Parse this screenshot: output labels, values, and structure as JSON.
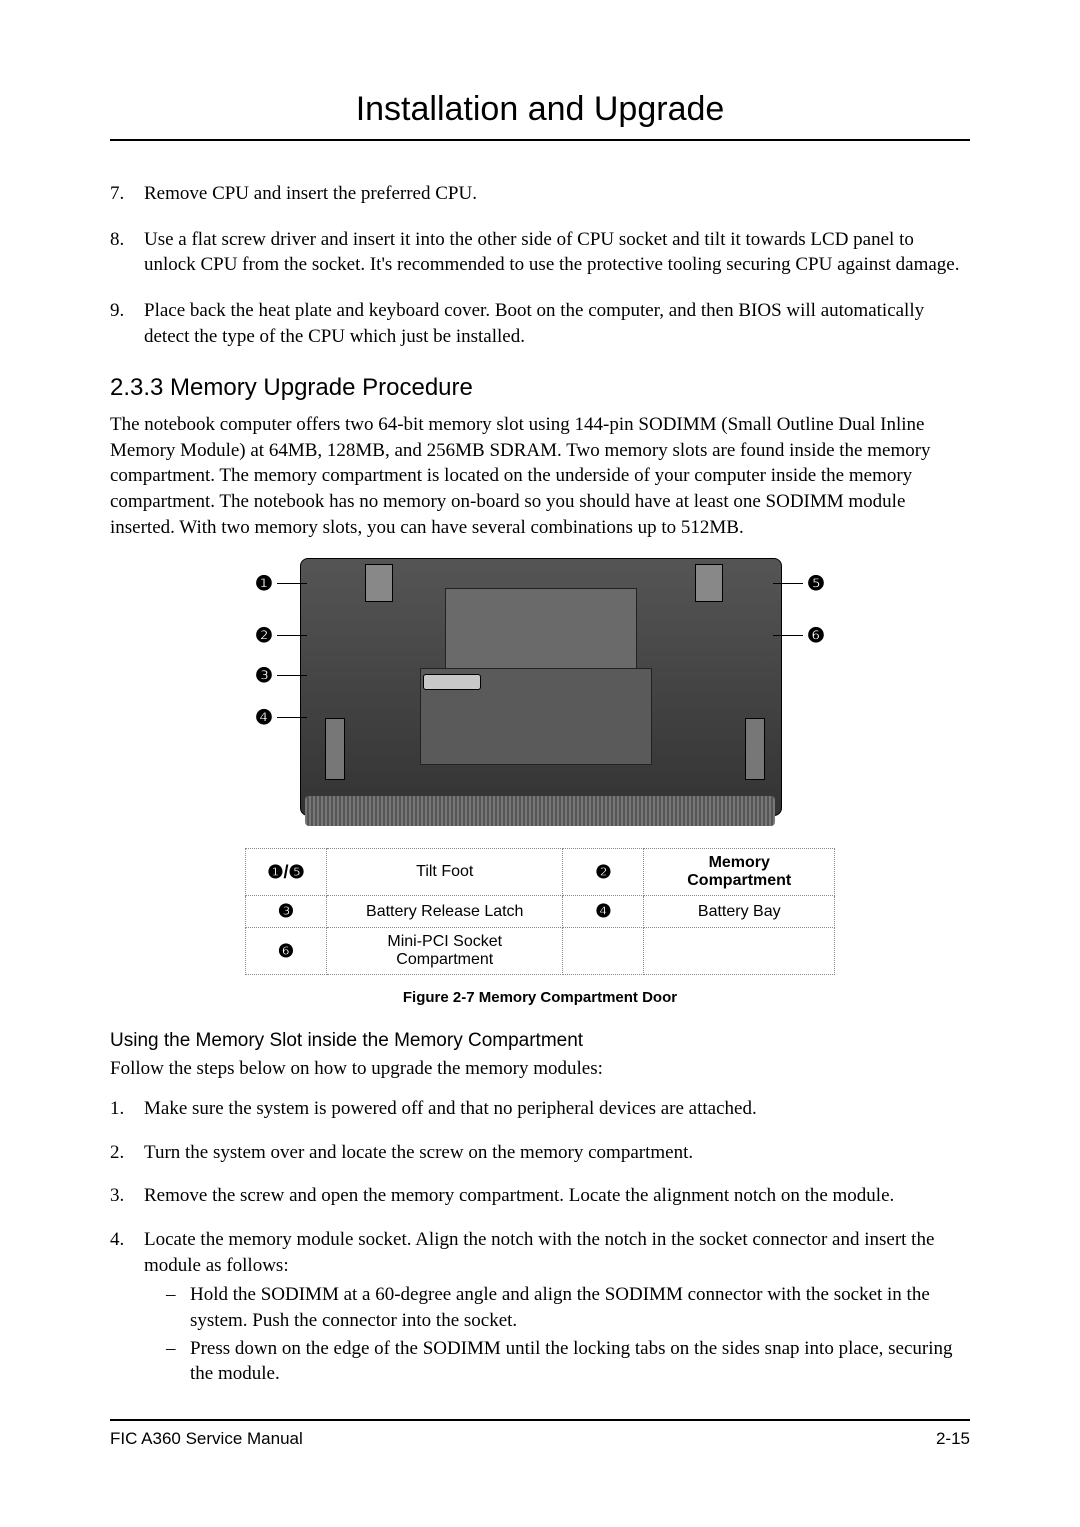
{
  "header": {
    "title": "Installation and Upgrade"
  },
  "steps_upper": {
    "s7": {
      "num": "7.",
      "text": "Remove CPU and insert the preferred CPU."
    },
    "s8": {
      "num": "8.",
      "text": "Use a flat screw driver and insert it into the other side of CPU socket and tilt it towards LCD panel to unlock CPU from the socket. It's recommended to use the protective tooling securing CPU against damage."
    },
    "s9": {
      "num": "9.",
      "text": "Place back the heat plate and keyboard cover. Boot on the computer, and then BIOS will automatically detect the type of the CPU which just be installed."
    }
  },
  "section": {
    "heading": "2.3.3 Memory Upgrade Procedure",
    "para": "The notebook computer offers two 64-bit memory slot using 144-pin SODIMM (Small Outline Dual Inline Memory Module) at 64MB, 128MB, and 256MB SDRAM. Two memory slots are found inside the memory compartment. The memory compartment is located on the underside of your computer inside the memory compartment. The notebook has no memory on-board so you should have at least one SODIMM module inserted. With two memory slots, you can have several combinations up to 512MB."
  },
  "callouts": {
    "c1": "❶",
    "c2": "❷",
    "c3": "❸",
    "c4": "❹",
    "c5": "❺",
    "c6": "❻"
  },
  "legend": {
    "r1": {
      "num": "❶/❺",
      "label": "Tilt Foot",
      "num2": "❷",
      "label2": "Memory Compartment"
    },
    "r2": {
      "num": "❸",
      "label": "Battery Release Latch",
      "num2": "❹",
      "label2": "Battery Bay"
    },
    "r3": {
      "num": "❻",
      "label": "Mini-PCI Socket Compartment",
      "num2": "",
      "label2": ""
    }
  },
  "figure_caption": "Figure 2-7      Memory Compartment Door",
  "sub": {
    "heading": "Using the Memory Slot inside the Memory Compartment",
    "intro": "Follow the steps below on how to upgrade the memory modules:"
  },
  "steps_lower": {
    "s1": {
      "num": "1.",
      "text": "Make sure the system is powered off and that no peripheral devices are attached."
    },
    "s2": {
      "num": "2.",
      "text": "Turn the system over and locate the screw on the memory compartment."
    },
    "s3": {
      "num": "3.",
      "text": "Remove the screw and open the memory compartment. Locate the alignment notch on the module."
    },
    "s4": {
      "num": "4.",
      "text": "Locate the memory module socket. Align the notch with the notch in the socket connector and insert the module as follows:"
    }
  },
  "substeps": {
    "a": {
      "dash": "–",
      "text": "Hold the SODIMM at a 60-degree angle and align the SODIMM connector with the socket in the system. Push the connector into the socket."
    },
    "b": {
      "dash": "–",
      "text": "Press down on the edge of the SODIMM until the locking tabs on the sides snap into place, securing the module."
    }
  },
  "footer": {
    "left": "FIC A360 Service Manual",
    "right": "2-15"
  }
}
